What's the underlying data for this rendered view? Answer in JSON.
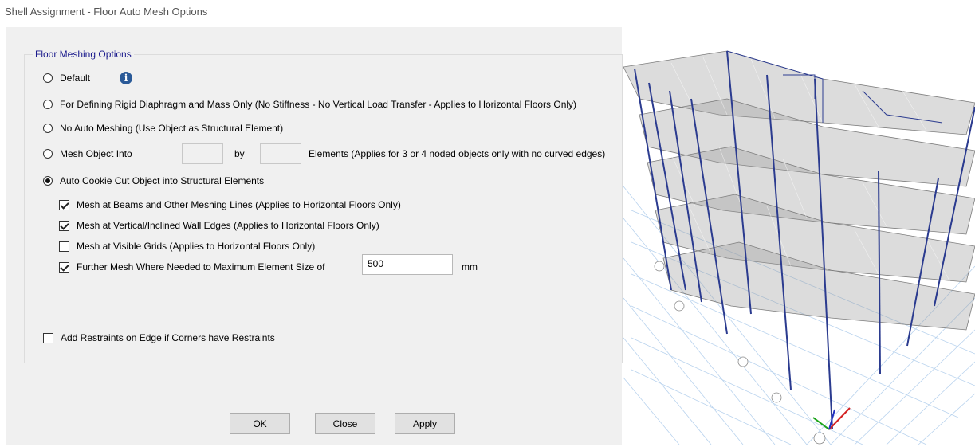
{
  "window": {
    "title": "Shell Assignment - Floor Auto Mesh Options"
  },
  "group": {
    "label": "Floor Meshing Options"
  },
  "options": {
    "default": "Default",
    "rigid": "For Defining Rigid Diaphragm and Mass Only  (No Stiffness - No Vertical Load Transfer - Applies to Horizontal Floors Only)",
    "no_auto": "No Auto Meshing  (Use Object as Structural Element)",
    "mesh_into": "Mesh Object Into",
    "by": "by",
    "elements_note": "Elements (Applies for 3 or 4 noded objects only with no curved edges)",
    "cookie_cut": "Auto Cookie Cut Object into Structural Elements"
  },
  "checks": {
    "beams": {
      "label": "Mesh at Beams and Other Meshing Lines  (Applies to Horizontal Floors Only)",
      "checked": true
    },
    "walls": {
      "label": "Mesh at Vertical/Inclined Wall Edges  (Applies to Horizontal Floors Only)",
      "checked": true
    },
    "grids": {
      "label": "Mesh at Visible Grids  (Applies to Horizontal Floors Only)",
      "checked": false
    },
    "further": {
      "label": "Further Mesh Where Needed to Maximum Element Size of",
      "checked": true
    },
    "restraints": {
      "label": "Add Restraints on Edge if Corners have Restraints",
      "checked": false
    }
  },
  "max_size": {
    "value": "500",
    "unit": "mm"
  },
  "buttons": {
    "ok": "OK",
    "close": "Close",
    "apply": "Apply"
  },
  "model_view": {
    "icon": "3d-building-frame-model"
  }
}
